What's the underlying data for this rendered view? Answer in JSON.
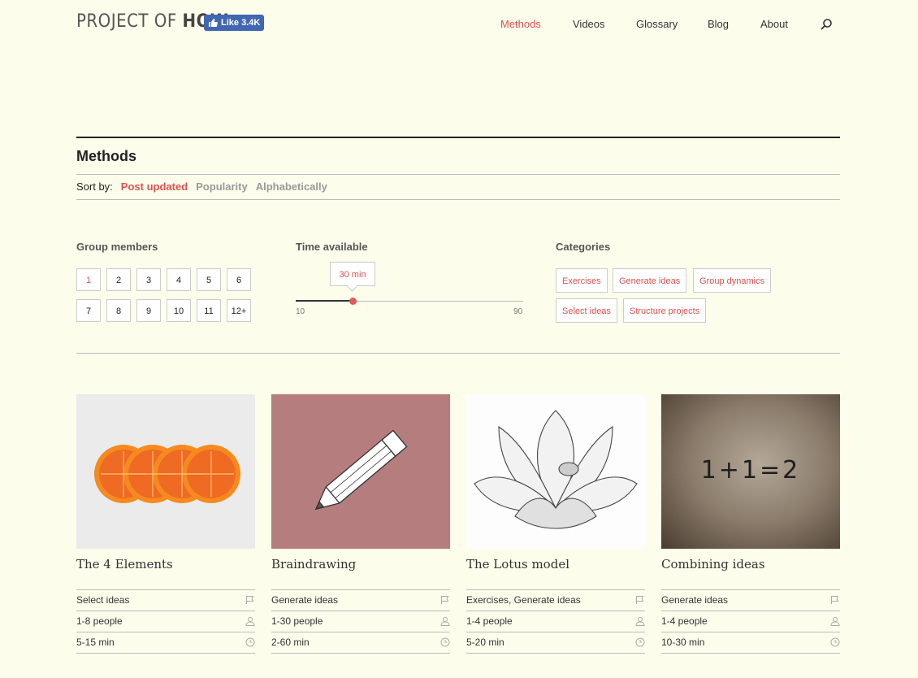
{
  "header": {
    "logo_light": "PROJECT OF ",
    "logo_bold": "HOW",
    "fb_like_label": "Like 3.4K",
    "nav": [
      "Methods",
      "Videos",
      "Glossary",
      "Blog",
      "About"
    ],
    "active_nav": "Methods"
  },
  "page": {
    "title": "Methods",
    "sort_label": "Sort by:",
    "sort_options": [
      "Post updated",
      "Popularity",
      "Alphabetically"
    ],
    "active_sort": "Post updated"
  },
  "filters": {
    "group_members": {
      "heading": "Group members",
      "options": [
        "1",
        "2",
        "3",
        "4",
        "5",
        "6",
        "7",
        "8",
        "9",
        "10",
        "11",
        "12+"
      ],
      "selected": "1"
    },
    "time": {
      "heading": "Time available",
      "value_label": "30 min",
      "min_label": "10",
      "max_label": "90",
      "value": 30
    },
    "categories": {
      "heading": "Categories",
      "options": [
        "Exercises",
        "Generate ideas",
        "Group dynamics",
        "Select ideas",
        "Structure projects"
      ]
    }
  },
  "cards": [
    {
      "title": "The 4 Elements",
      "category": "Select ideas",
      "people": "1-8 people",
      "time": "5-15 min",
      "bg": "#ebebeb"
    },
    {
      "title": "Braindrawing",
      "category": "Generate ideas",
      "people": "1-30 people",
      "time": "2-60 min",
      "bg": "#b57d7d"
    },
    {
      "title": "The Lotus model",
      "category": "Exercises, Generate ideas",
      "people": "1-4 people",
      "time": "5-20 min",
      "bg": "#fdfdfd"
    },
    {
      "title": "Combining ideas",
      "category": "Generate ideas",
      "people": "1-4 people",
      "time": "10-30 min",
      "bg": "#6e5c4c",
      "image_text": "1+1=2"
    }
  ],
  "colors": {
    "accent": "#d9534f",
    "background": "#fdfdec",
    "facebook": "#4267b2"
  }
}
